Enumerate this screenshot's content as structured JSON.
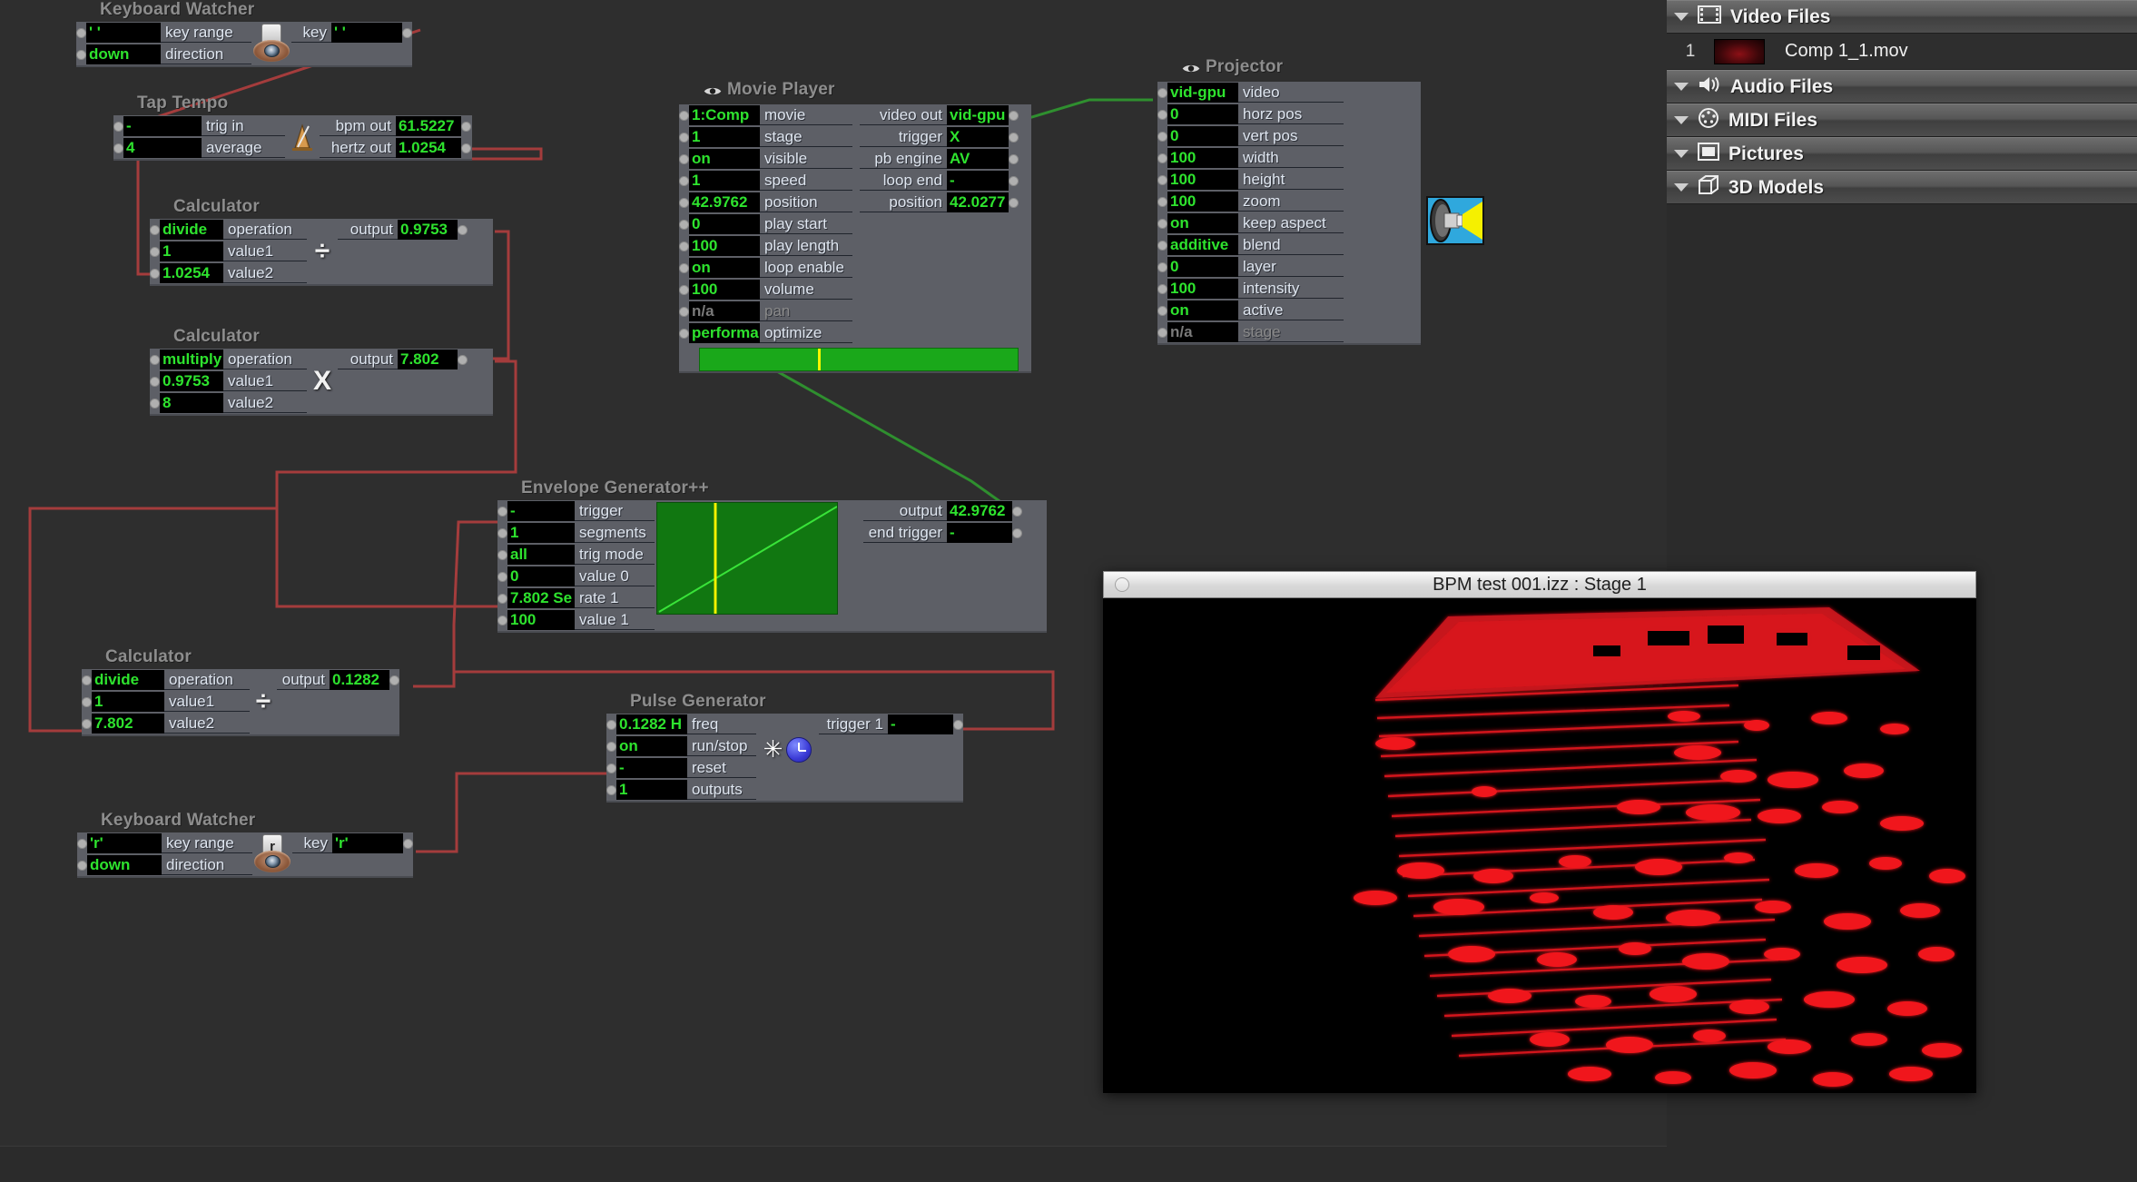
{
  "app": {
    "background": "#2e2e2e",
    "wire_color_control": "#a13d3d",
    "wire_color_video": "#2e8b2e",
    "value_color": "#2ee32e"
  },
  "patch": {
    "actors": [
      {
        "id": "keyboard-watcher-1",
        "title": "Keyboard Watcher",
        "icon": "eyeball-keycap-icon",
        "keycap": "",
        "inputs": [
          {
            "value": "' '",
            "label": "key range"
          },
          {
            "value": "down",
            "label": "direction"
          }
        ],
        "outputs": [
          {
            "label": "key",
            "value": "' '"
          }
        ]
      },
      {
        "id": "tap-tempo",
        "title": "Tap Tempo",
        "icon": "metronome-icon",
        "inputs": [
          {
            "value": "-",
            "label": "trig in"
          },
          {
            "value": "4",
            "label": "average"
          }
        ],
        "outputs": [
          {
            "label": "bpm out",
            "value": "61.5227"
          },
          {
            "label": "hertz out",
            "value": "1.0254"
          }
        ]
      },
      {
        "id": "calculator-1",
        "title": "Calculator",
        "icon": "divide-icon",
        "op_glyph": "÷",
        "inputs": [
          {
            "value": "divide",
            "label": "operation"
          },
          {
            "value": "1",
            "label": "value1"
          },
          {
            "value": "1.0254",
            "label": "value2"
          }
        ],
        "outputs": [
          {
            "label": "output",
            "value": "0.9753"
          }
        ]
      },
      {
        "id": "calculator-2",
        "title": "Calculator",
        "icon": "multiply-icon",
        "op_glyph": "X",
        "inputs": [
          {
            "value": "multiply",
            "label": "operation"
          },
          {
            "value": "0.9753",
            "label": "value1"
          },
          {
            "value": "8",
            "label": "value2"
          }
        ],
        "outputs": [
          {
            "label": "output",
            "value": "7.802"
          }
        ]
      },
      {
        "id": "movie-player",
        "title": "Movie Player",
        "icon": "eye-icon",
        "inputs": [
          {
            "value": "1:Comp",
            "label": "movie"
          },
          {
            "value": "1",
            "label": "stage"
          },
          {
            "value": "on",
            "label": "visible"
          },
          {
            "value": "1",
            "label": "speed"
          },
          {
            "value": "42.9762",
            "label": "position"
          },
          {
            "value": "0",
            "label": "play start"
          },
          {
            "value": "100",
            "label": "play length"
          },
          {
            "value": "on",
            "label": "loop enable"
          },
          {
            "value": "100",
            "label": "volume"
          },
          {
            "value": "n/a",
            "label": "pan",
            "disabled": true
          },
          {
            "value": "performa",
            "label": "optimize"
          }
        ],
        "outputs": [
          {
            "label": "video out",
            "value": "vid-gpu"
          },
          {
            "label": "trigger",
            "value": "X"
          },
          {
            "label": "pb engine",
            "value": "AV"
          },
          {
            "label": "loop end",
            "value": "-"
          },
          {
            "label": "position",
            "value": "42.0277"
          }
        ],
        "scrubber": {
          "playhead_percent": 37
        }
      },
      {
        "id": "projector",
        "title": "Projector",
        "icon": "projector-lamp-icon",
        "inputs": [
          {
            "value": "vid-gpu",
            "label": "video"
          },
          {
            "value": "0",
            "label": "horz pos"
          },
          {
            "value": "0",
            "label": "vert pos"
          },
          {
            "value": "100",
            "label": "width"
          },
          {
            "value": "100",
            "label": "height"
          },
          {
            "value": "100",
            "label": "zoom"
          },
          {
            "value": "on",
            "label": "keep aspect"
          },
          {
            "value": "additive",
            "label": "blend"
          },
          {
            "value": "0",
            "label": "layer"
          },
          {
            "value": "100",
            "label": "intensity"
          },
          {
            "value": "on",
            "label": "active"
          },
          {
            "value": "n/a",
            "label": "stage",
            "disabled": true
          }
        ],
        "outputs": []
      },
      {
        "id": "envelope-generator",
        "title": "Envelope Generator++",
        "icon": "envelope-graph-icon",
        "inputs": [
          {
            "value": "-",
            "label": "trigger"
          },
          {
            "value": "1",
            "label": "segments"
          },
          {
            "value": "all",
            "label": "trig mode"
          },
          {
            "value": "0",
            "label": "value 0"
          },
          {
            "value": "7.802 Se",
            "label": "rate 1"
          },
          {
            "value": "100",
            "label": "value 1"
          }
        ],
        "outputs": [
          {
            "label": "output",
            "value": "42.9762"
          },
          {
            "label": "end trigger",
            "value": "-"
          }
        ],
        "graph": {
          "playhead_percent": 32
        }
      },
      {
        "id": "calculator-3",
        "title": "Calculator",
        "icon": "divide-icon",
        "op_glyph": "÷",
        "inputs": [
          {
            "value": "divide",
            "label": "operation"
          },
          {
            "value": "1",
            "label": "value1"
          },
          {
            "value": "7.802",
            "label": "value2"
          }
        ],
        "outputs": [
          {
            "label": "output",
            "value": "0.1282"
          }
        ]
      },
      {
        "id": "pulse-generator",
        "title": "Pulse Generator",
        "icon": "clock-icon",
        "inputs": [
          {
            "value": "0.1282 H",
            "label": "freq"
          },
          {
            "value": "on",
            "label": "run/stop"
          },
          {
            "value": "-",
            "label": "reset"
          },
          {
            "value": "1",
            "label": "outputs"
          }
        ],
        "outputs": [
          {
            "label": "trigger 1",
            "value": "-"
          }
        ]
      },
      {
        "id": "keyboard-watcher-2",
        "title": "Keyboard Watcher",
        "icon": "eyeball-keycap-icon",
        "keycap": "r",
        "inputs": [
          {
            "value": "'r'",
            "label": "key range"
          },
          {
            "value": "down",
            "label": "direction"
          }
        ],
        "outputs": [
          {
            "label": "key",
            "value": "'r'"
          }
        ]
      }
    ]
  },
  "media_panel": {
    "bins": [
      {
        "label": "Video Files",
        "icon": "film-strip-icon",
        "expanded": true,
        "items": [
          {
            "index": "1",
            "thumbnail": "red-cube-thumb",
            "filename": "Comp 1_1.mov"
          }
        ]
      },
      {
        "label": "Audio Files",
        "icon": "speaker-icon",
        "expanded": true,
        "items": []
      },
      {
        "label": "MIDI Files",
        "icon": "midi-connector-icon",
        "expanded": true,
        "items": []
      },
      {
        "label": "Pictures",
        "icon": "picture-frame-icon",
        "expanded": true,
        "items": []
      },
      {
        "label": "3D Models",
        "icon": "cube-icon",
        "expanded": true,
        "items": []
      }
    ]
  },
  "stage_window": {
    "title": "BPM test 001.izz : Stage 1",
    "close_button": "close-button"
  }
}
